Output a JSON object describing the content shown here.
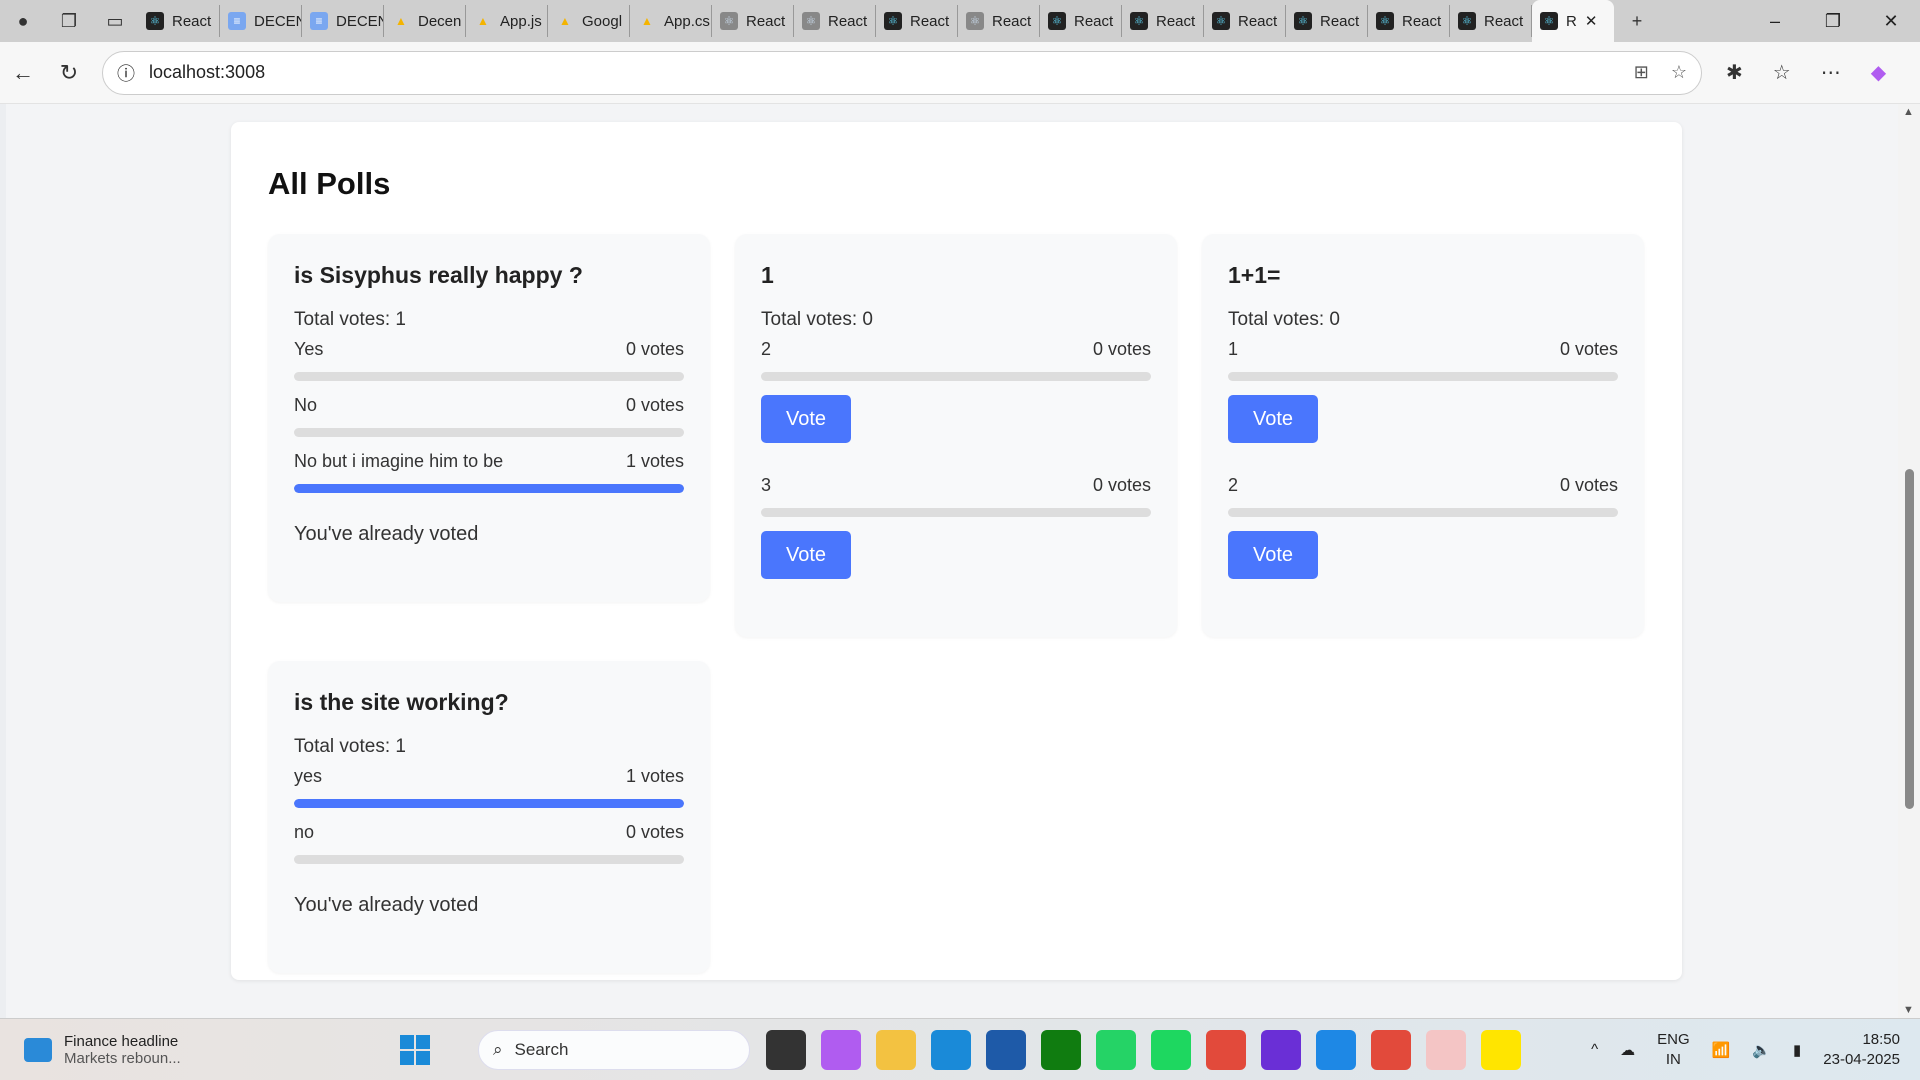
{
  "browser": {
    "tabs": [
      {
        "label": "React",
        "icon": "react"
      },
      {
        "label": "DECEN",
        "icon": "doc"
      },
      {
        "label": "DECEN",
        "icon": "doc"
      },
      {
        "label": "Decen",
        "icon": "drive"
      },
      {
        "label": "App.js",
        "icon": "drive"
      },
      {
        "label": "Googl",
        "icon": "drive"
      },
      {
        "label": "App.cs",
        "icon": "drive"
      },
      {
        "label": "React",
        "icon": "react-g"
      },
      {
        "label": "React",
        "icon": "react-g"
      },
      {
        "label": "React",
        "icon": "react"
      },
      {
        "label": "React",
        "icon": "react-g"
      },
      {
        "label": "React",
        "icon": "react"
      },
      {
        "label": "React",
        "icon": "react"
      },
      {
        "label": "React",
        "icon": "react"
      },
      {
        "label": "React",
        "icon": "react"
      },
      {
        "label": "React",
        "icon": "react"
      },
      {
        "label": "React",
        "icon": "react"
      }
    ],
    "active_tab": "R",
    "url": "localhost:3008"
  },
  "page": {
    "title": "All Polls",
    "vote_label": "Vote",
    "already_voted": "You've already voted",
    "total_prefix": "Total votes: ",
    "polls": [
      {
        "question": "is Sisyphus really happy ?",
        "total": "Total votes: 1",
        "voted": true,
        "options": [
          {
            "label": "Yes",
            "votes": "0 votes",
            "pct": 0
          },
          {
            "label": "No",
            "votes": "0 votes",
            "pct": 0
          },
          {
            "label": "No but i imagine him to be",
            "votes": "1 votes",
            "pct": 100
          }
        ]
      },
      {
        "question": "1",
        "total": "Total votes: 0",
        "voted": false,
        "options": [
          {
            "label": "2",
            "votes": "0 votes",
            "pct": 0
          },
          {
            "label": "3",
            "votes": "0 votes",
            "pct": 0
          }
        ]
      },
      {
        "question": "1+1=",
        "total": "Total votes: 0",
        "voted": false,
        "options": [
          {
            "label": "1",
            "votes": "0 votes",
            "pct": 0
          },
          {
            "label": "2",
            "votes": "0 votes",
            "pct": 0
          }
        ]
      },
      {
        "question": "is the site working?",
        "total": "Total votes: 1",
        "voted": true,
        "options": [
          {
            "label": "yes",
            "votes": "1 votes",
            "pct": 100
          },
          {
            "label": "no",
            "votes": "0 votes",
            "pct": 0
          }
        ]
      }
    ]
  },
  "colors": {
    "accent": "#4a76fd",
    "card": "#f8f9fa",
    "track": "#dddddd"
  },
  "taskbar": {
    "news_title": "Finance headline",
    "news_sub": "Markets reboun...",
    "search": "Search",
    "lang1": "ENG",
    "lang2": "IN",
    "time": "18:50",
    "date": "23-04-2025",
    "apps": [
      {
        "name": "task-view",
        "color": "#333"
      },
      {
        "name": "copilot",
        "color": "#b05cf0"
      },
      {
        "name": "file-explorer",
        "color": "#f3c241"
      },
      {
        "name": "edge",
        "color": "#1a8ad8"
      },
      {
        "name": "store",
        "color": "#1e5aa8"
      },
      {
        "name": "xbox",
        "color": "#107c10"
      },
      {
        "name": "whatsapp",
        "color": "#25d366"
      },
      {
        "name": "spotify",
        "color": "#1ed760"
      },
      {
        "name": "chrome",
        "color": "#e24a3b"
      },
      {
        "name": "app-purple",
        "color": "#6a2fd6"
      },
      {
        "name": "vscode",
        "color": "#1e88e5"
      },
      {
        "name": "chrome",
        "color": "#e24a3b"
      },
      {
        "name": "file-app",
        "color": "#f4c5c5"
      },
      {
        "name": "checklist-app",
        "color": "#ffe500"
      }
    ]
  }
}
